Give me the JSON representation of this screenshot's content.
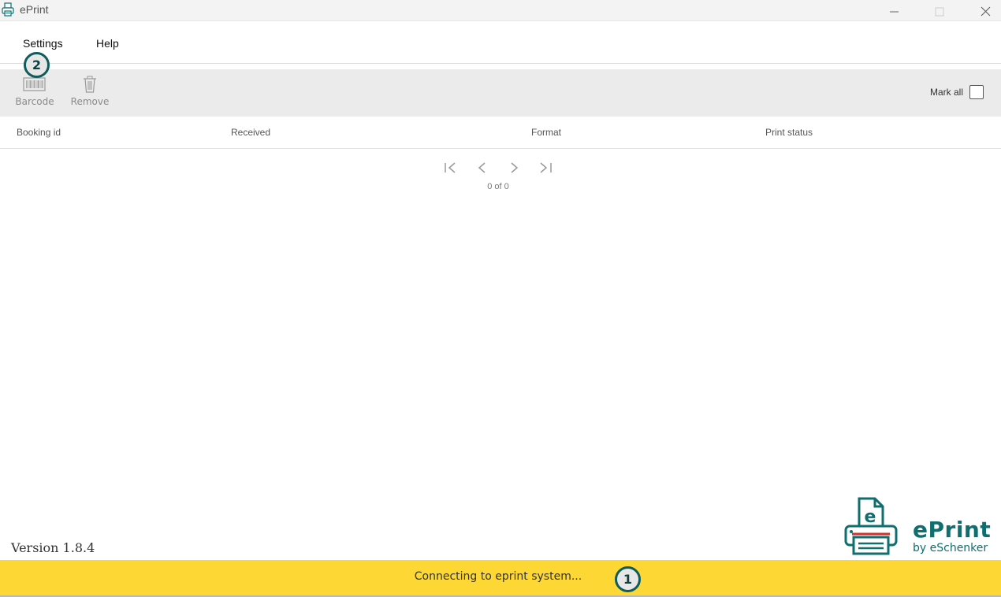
{
  "window": {
    "title": "ePrint",
    "icons": [
      "printer-icon",
      "minimize-icon",
      "maximize-icon",
      "close-icon"
    ]
  },
  "menu": {
    "settings": "Settings",
    "help": "Help"
  },
  "toolbar": {
    "barcode_label": "Barcode",
    "remove_label": "Remove",
    "mark_all_label": "Mark all",
    "mark_all_checked": false
  },
  "table": {
    "columns": [
      "Booking id",
      "Received",
      "Format",
      "Print status"
    ],
    "rows": []
  },
  "pagination": {
    "count_text": "0 of 0"
  },
  "footer": {
    "version": "Version 1.8.4",
    "brand": "ePrint",
    "brand_sub": "by eSchenker"
  },
  "status": {
    "message": "Connecting to eprint system...",
    "color": "#fdd835"
  },
  "markers": {
    "one": "1",
    "two": "2"
  },
  "colors": {
    "brand": "#0f6e6e",
    "accent_red": "#d32f2f"
  }
}
